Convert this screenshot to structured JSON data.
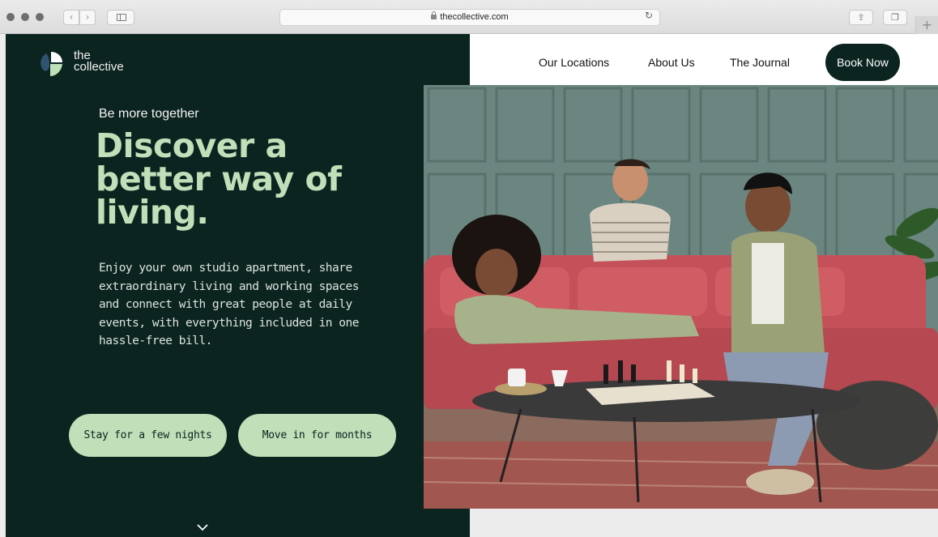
{
  "browser": {
    "url": "thecollective.com"
  },
  "brand": {
    "logo_line1": "the",
    "logo_line2": "collective"
  },
  "nav": {
    "links": [
      "Our Locations",
      "About Us",
      "The Journal"
    ],
    "cta": "Book Now"
  },
  "hero": {
    "tagline": "Be more together",
    "headline_lines": [
      "Discover a",
      "better way of",
      "living."
    ],
    "body_lines": [
      "Enjoy your own studio apartment, share",
      "extraordinary living and working spaces",
      "and connect with great people at daily",
      "events, with everything included in one",
      "hassle-free bill."
    ],
    "buttons": {
      "stay": "Stay for a few nights",
      "move": "Move in for months"
    }
  },
  "colors": {
    "dark_green": "#0b2420",
    "mint": "#bfe0b8",
    "wall": "#6b8680",
    "sofa": "#c8545a"
  },
  "icons": [
    "back-icon",
    "forward-icon",
    "sidebar-icon",
    "lock-icon",
    "reload-icon",
    "share-icon",
    "tabs-icon",
    "plus-icon",
    "logo-icon",
    "chevron-down-icon"
  ]
}
